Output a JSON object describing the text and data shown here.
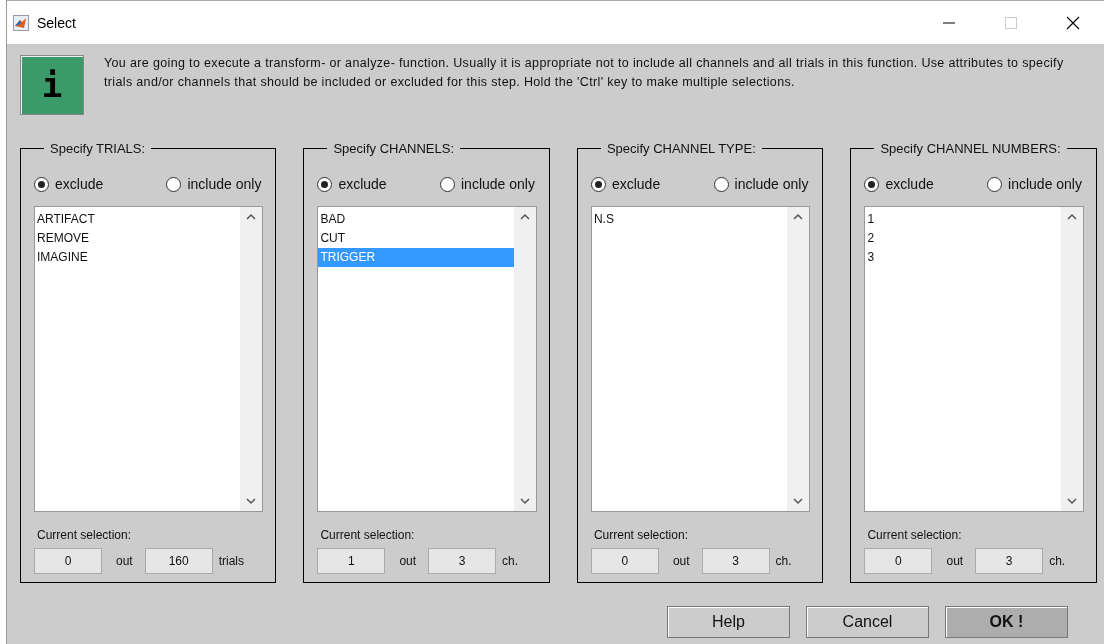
{
  "window": {
    "title": "Select"
  },
  "info": {
    "icon_text": "i",
    "message": "You are going to execute a transform- or analyze- function. Usually it is appropriate not to include all channels and all trials in this function. Use attributes to specify trials and/or channels that should be included or excluded for this step. Hold the 'Ctrl' key to make multiple selections."
  },
  "panels": [
    {
      "title": "Specify TRIALS:",
      "options": [
        {
          "label": "exclude",
          "selected": true
        },
        {
          "label": "include only",
          "selected": false
        }
      ],
      "items": [
        {
          "label": "ARTIFACT",
          "selected": false
        },
        {
          "label": "REMOVE",
          "selected": false
        },
        {
          "label": "IMAGINE",
          "selected": false
        }
      ],
      "selection_label": "Current selection:",
      "count": "0",
      "out_label": "out",
      "total": "160",
      "unit": "trials"
    },
    {
      "title": "Specify CHANNELS:",
      "options": [
        {
          "label": "exclude",
          "selected": true
        },
        {
          "label": "include only",
          "selected": false
        }
      ],
      "items": [
        {
          "label": "BAD",
          "selected": false
        },
        {
          "label": "CUT",
          "selected": false
        },
        {
          "label": "TRIGGER",
          "selected": true
        }
      ],
      "selection_label": "Current selection:",
      "count": "1",
      "out_label": "out",
      "total": "3",
      "unit": "ch."
    },
    {
      "title": "Specify CHANNEL TYPE:",
      "options": [
        {
          "label": "exclude",
          "selected": true
        },
        {
          "label": "include only",
          "selected": false
        }
      ],
      "items": [
        {
          "label": "N.S",
          "selected": false
        }
      ],
      "selection_label": "Current selection:",
      "count": "0",
      "out_label": "out",
      "total": "3",
      "unit": "ch."
    },
    {
      "title": "Specify CHANNEL NUMBERS:",
      "options": [
        {
          "label": "exclude",
          "selected": true
        },
        {
          "label": "include only",
          "selected": false
        }
      ],
      "items": [
        {
          "label": "1",
          "selected": false
        },
        {
          "label": "2",
          "selected": false
        },
        {
          "label": "3",
          "selected": false
        }
      ],
      "selection_label": "Current selection:",
      "count": "0",
      "out_label": "out",
      "total": "3",
      "unit": "ch."
    }
  ],
  "buttons": [
    {
      "label": "Help",
      "kind": "normal"
    },
    {
      "label": "Cancel",
      "kind": "normal"
    },
    {
      "label": "OK !",
      "kind": "default"
    }
  ]
}
